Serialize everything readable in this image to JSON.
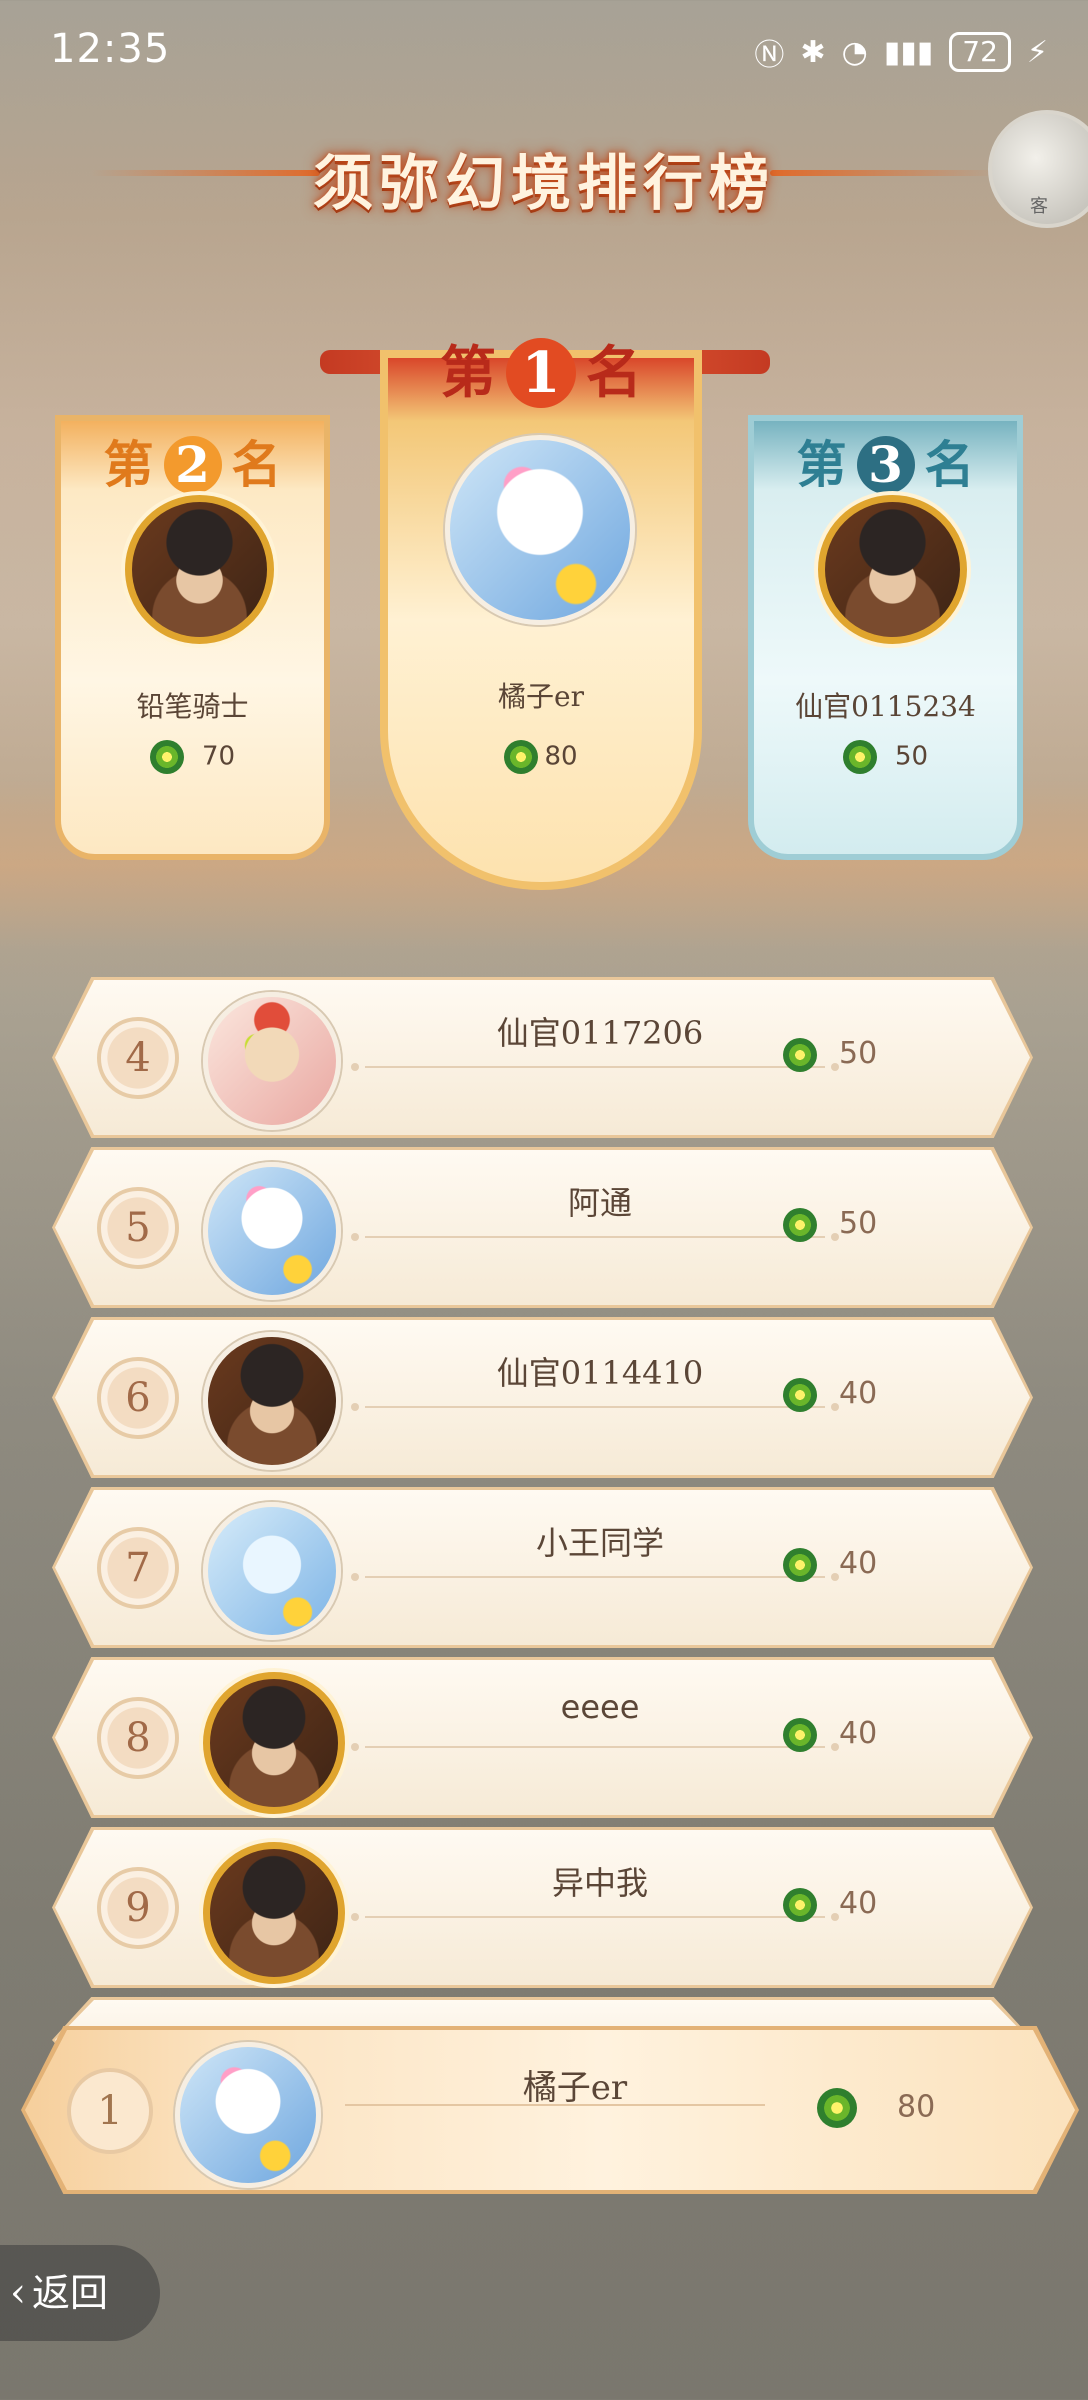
{
  "status_bar": {
    "time": "12:35",
    "battery": "72"
  },
  "title": "须弥幻境排行榜",
  "corner_button_label": "客",
  "podium": {
    "rank_prefix": "第",
    "rank_suffix": "名",
    "first": {
      "rank": "1",
      "name": "橘子er",
      "score": "80"
    },
    "second": {
      "rank": "2",
      "name": "铅笔骑士",
      "score": "70"
    },
    "third": {
      "rank": "3",
      "name": "仙官0115234",
      "score": "50"
    }
  },
  "list": [
    {
      "rank": "4",
      "name": "仙官0117206",
      "score": "50",
      "avatar": "jester"
    },
    {
      "rank": "5",
      "name": "阿通",
      "score": "50",
      "avatar": "ghost"
    },
    {
      "rank": "6",
      "name": "仙官0114410",
      "score": "40",
      "avatar": "knight"
    },
    {
      "rank": "7",
      "name": "小王同学",
      "score": "40",
      "avatar": "blue"
    },
    {
      "rank": "8",
      "name": "eeee",
      "score": "40",
      "avatar": "knight"
    },
    {
      "rank": "9",
      "name": "异中我",
      "score": "40",
      "avatar": "knight"
    }
  ],
  "my_row": {
    "rank": "1",
    "name": "橘子er",
    "score": "80"
  },
  "back_label": "返回",
  "colors": {
    "title_glow": "#c44d1c",
    "first_banner": "#d9472a",
    "second_banner": "#f3b15f",
    "third_banner": "#77b3c0"
  }
}
